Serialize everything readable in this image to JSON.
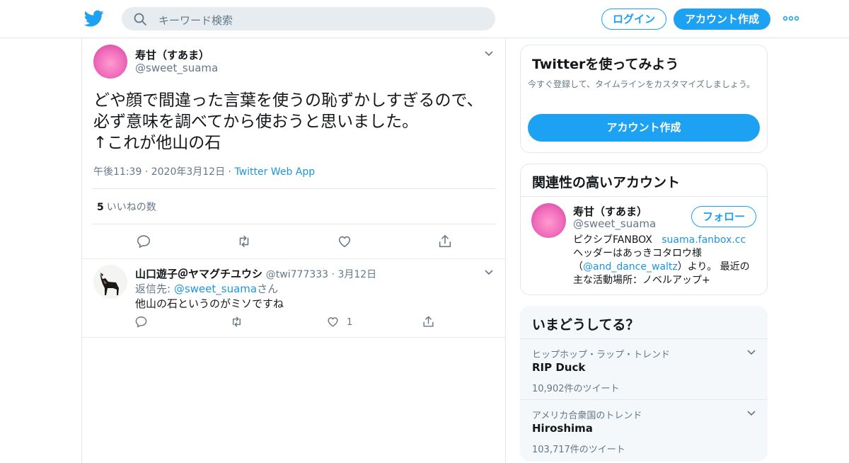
{
  "header": {
    "search_placeholder": "キーワード検索",
    "login_label": "ログイン",
    "signup_label": "アカウント作成",
    "accent": "#1da1f2"
  },
  "tweet": {
    "author_name": "寿甘（すあま）",
    "author_handle": "@sweet_suama",
    "text_lines": [
      "どや顔で間違った言葉を使うの恥ずかしすぎるので、",
      "必ず意味を調べてから使おうと思いました。",
      "↑これが他山の石"
    ],
    "time": "午後11:39",
    "date": "2020年3月12日",
    "source": "Twitter Web App",
    "like_count": "5",
    "like_label": "いいねの数"
  },
  "reply": {
    "author_name": "山口遊子＠ヤマグチユウシ",
    "author_handle": "@twi777333",
    "date": "3月12日",
    "reply_to_prefix": "返信先: ",
    "reply_to_handle": "@sweet_suama",
    "reply_to_suffix": "さん",
    "text": "他山の石というのがミソですね",
    "like_count": "1"
  },
  "sidebar": {
    "try_card": {
      "title": "Twitterを使ってみよう",
      "subtitle": "今すぐ登録して、タイムラインをカスタマイズしましょう。",
      "button_label": "アカウント作成"
    },
    "related_card": {
      "title": "関連性の高いアカウント",
      "account_name": "寿甘（すあま）",
      "account_handle": "@sweet_suama",
      "follow_label": "フォロー",
      "bio_part1": "ピクシブFANBOX",
      "bio_link1": "suama.fanbox.cc",
      "bio_part2": "ヘッダーはあっきコタロウ様",
      "bio_paren_open": "（",
      "bio_link2": "@and_dance_waltz",
      "bio_part3": "）より。 最近の主な活動場所：ノベルアップ+"
    },
    "trends_card": {
      "title": "いまどうしてる？",
      "items": [
        {
          "category": "ヒップホップ・ラップ・トレンド",
          "name": "RIP Duck",
          "count": "10,902件のツイート"
        },
        {
          "category": "アメリカ合衆国のトレンド",
          "name": "Hiroshima",
          "count": "103,717件のツイート"
        }
      ]
    }
  }
}
